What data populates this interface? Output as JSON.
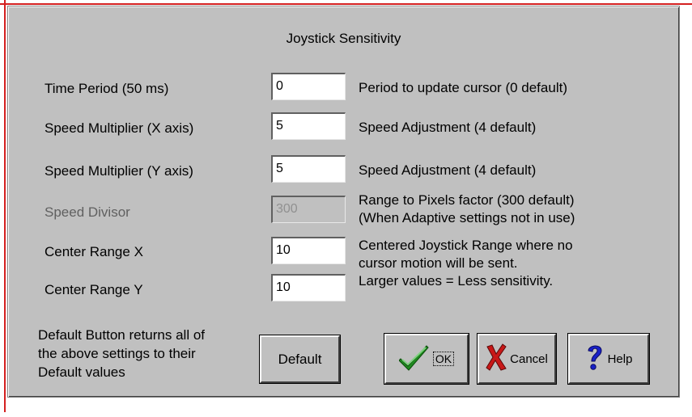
{
  "dialog": {
    "title": "Joystick Sensitivity"
  },
  "settings": [
    {
      "label": "Time Period (50 ms)",
      "value": "0",
      "description": [
        "Period to update cursor (0 default)"
      ],
      "disabled": false
    },
    {
      "label": "Speed Multiplier (X axis)",
      "value": "5",
      "description": [
        "Speed Adjustment (4 default)"
      ],
      "disabled": false
    },
    {
      "label": "Speed Multiplier (Y axis)",
      "value": "5",
      "description": [
        "Speed Adjustment (4 default)"
      ],
      "disabled": false
    },
    {
      "label": "Speed Divisor",
      "value": "300",
      "description": [
        "Range to Pixels factor (300 default)",
        "(When Adaptive settings not in use)"
      ],
      "disabled": true
    },
    {
      "label": "Center Range X",
      "value": "10",
      "description": [
        "Centered Joystick Range where no",
        "cursor motion will be sent."
      ],
      "disabled": false
    },
    {
      "label": "Center Range Y",
      "value": "10",
      "description": [
        "Larger values = Less sensitivity."
      ],
      "disabled": false
    }
  ],
  "footer": {
    "note_lines": [
      "Default Button returns all of",
      "the above settings to their",
      "Default values"
    ],
    "default_label": "Default",
    "ok_label": "OK",
    "cancel_label": "Cancel",
    "help_label": "Help"
  },
  "icons": {
    "ok": "checkmark-icon",
    "cancel": "red-x-icon",
    "help": "question-mark-icon"
  },
  "colors": {
    "dialog_bg": "#c0c0c0",
    "check_green": "#1f8a1f",
    "cancel_red": "#c81818",
    "help_blue": "#1820c8"
  }
}
